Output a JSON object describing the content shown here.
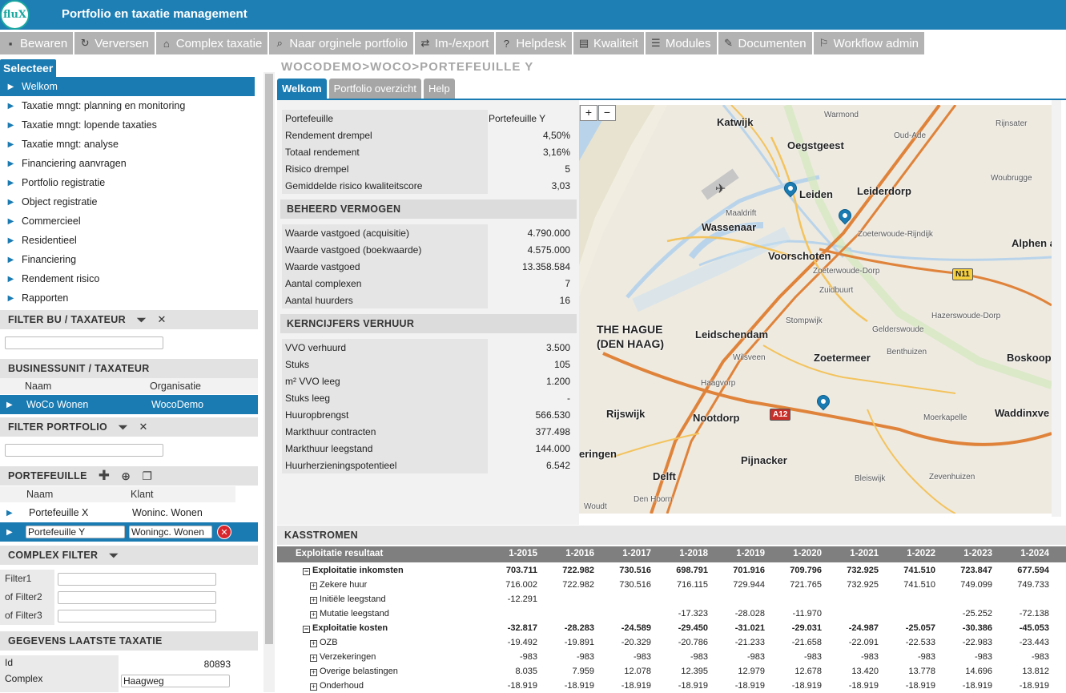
{
  "app": {
    "logo": "fluX",
    "title": "Portfolio en taxatie management"
  },
  "toolbar": [
    {
      "icon": "save-icon",
      "glyph": "▪",
      "label": "Bewaren"
    },
    {
      "icon": "refresh-icon",
      "glyph": "↻",
      "label": "Verversen"
    },
    {
      "icon": "home-icon",
      "glyph": "⌂",
      "label": "Complex taxatie"
    },
    {
      "icon": "search-icon",
      "glyph": "⌕",
      "label": "Naar orginele portfolio"
    },
    {
      "icon": "import-export-icon",
      "glyph": "⇄",
      "label": "Im-/export"
    },
    {
      "icon": "help-icon",
      "glyph": "?",
      "label": "Helpdesk"
    },
    {
      "icon": "quality-icon",
      "glyph": "▤",
      "label": "Kwaliteit"
    },
    {
      "icon": "modules-icon",
      "glyph": "☰",
      "label": "Modules"
    },
    {
      "icon": "documents-icon",
      "glyph": "✎",
      "label": "Documenten"
    },
    {
      "icon": "workflow-icon",
      "glyph": "⚐",
      "label": "Workflow admin"
    }
  ],
  "left": {
    "selecteer": "Selecteer",
    "nav": [
      "Welkom",
      "Taxatie mngt: planning en monitoring",
      "Taxatie mngt: lopende taxaties",
      "Taxatie mngt: analyse",
      "Financiering aanvragen",
      "Portfolio registratie",
      "Object registratie",
      "Commercieel",
      "Residentieel",
      "Financiering",
      "Rendement risico",
      "Rapporten"
    ],
    "filter_bu": "FILTER BU / TAXATEUR",
    "bu_head": "BUSINESSUNIT / TAXATEUR",
    "bu_cols": {
      "naam": "Naam",
      "organisatie": "Organisatie"
    },
    "bu_row": {
      "naam": "WoCo Wonen",
      "organisatie": "WocoDemo"
    },
    "filter_portfolio": "FILTER PORTFOLIO",
    "portefeuille": "PORTEFEUILLE",
    "pf_cols": {
      "naam": "Naam",
      "klant": "Klant"
    },
    "pf_row1": {
      "naam": "Portefeuille X",
      "klant": "Woninc. Wonen"
    },
    "pf_row2": {
      "naam": "Portefeuille Y",
      "klant": "Woningc. Wonen"
    },
    "complex_filter": "COMPLEX FILTER",
    "filters": [
      "Filter1",
      "of Filter2",
      "of Filter3"
    ],
    "gegevens": "GEGEVENS LAATSTE TAXATIE",
    "gegevens_rows": {
      "id_label": "Id",
      "id_value": "80893",
      "complex_label": "Complex",
      "complex_value": "Haagweg"
    }
  },
  "main": {
    "breadcrumb": "WOCODEMO>WOCO>PORTEFEUILLE Y",
    "tabs": [
      "Welkom",
      "Portfolio overzicht",
      "Help"
    ],
    "summary": [
      {
        "label": "Portefeuille",
        "value": "Portefeuille Y"
      },
      {
        "label": "Rendement drempel",
        "value": "4,50%"
      },
      {
        "label": "Totaal rendement",
        "value": "3,16%"
      },
      {
        "label": "Risico drempel",
        "value": "5"
      },
      {
        "label": "Gemiddelde risico kwaliteitscore",
        "value": "3,03"
      }
    ],
    "beheerd_head": "BEHEERD VERMOGEN",
    "beheerd": [
      {
        "label": "Waarde vastgoed (acquisitie)",
        "value": "4.790.000"
      },
      {
        "label": "Waarde vastgoed (boekwaarde)",
        "value": "4.575.000"
      },
      {
        "label": "Waarde vastgoed",
        "value": "13.358.584"
      },
      {
        "label": "Aantal complexen",
        "value": "7"
      },
      {
        "label": "Aantal huurders",
        "value": "16"
      }
    ],
    "kern_head": "KERNCIJFERS VERHUUR",
    "kern": [
      {
        "label": "VVO verhuurd",
        "value": "3.500"
      },
      {
        "label": "Stuks",
        "value": "105"
      },
      {
        "label": "m² VVO leeg",
        "value": "1.200"
      },
      {
        "label": "Stuks leeg",
        "value": "-"
      },
      {
        "label": "Huuropbrengst",
        "value": "566.530"
      },
      {
        "label": "Markthuur contracten",
        "value": "377.498"
      },
      {
        "label": "Markthuur leegstand",
        "value": "144.000"
      },
      {
        "label": "Huurherzieningspotentieel",
        "value": "6.542"
      }
    ],
    "map": {
      "zoom_in": "+",
      "zoom_out": "−",
      "places": [
        "Katwijk",
        "Oegstgeest",
        "Leiden",
        "Leiderdorp",
        "Wassenaar",
        "Voorschoten",
        "Alphen aa",
        "THE HAGUE",
        "(DEN HAAG)",
        "Leidschendam",
        "Zoetermeer",
        "Boskoop",
        "Rijswijk",
        "Nootdorp",
        "Waddinxve",
        "eringen",
        "Pijnacker",
        "Delft",
        "Warmond",
        "Oud-Ade",
        "Rijnsater",
        "Woubrugge",
        "Maaldrift",
        "Zoeterwoude-Rijndijk",
        "Zoeterwoude-Dorp",
        "Zuidbuurt",
        "Stompwijk",
        "Gelderswoude",
        "Hazerswoude-Dorp",
        "Wilsveen",
        "Benthuizen",
        "Haagvorp",
        "Moerkapelle",
        "Bleiswijk",
        "Zevenhuizen",
        "Woudt",
        "Den Hoorn"
      ],
      "roads": [
        "N11",
        "A12"
      ]
    },
    "kasstromen": {
      "head": "KASSTROMEN",
      "title": "Exploitatie resultaat",
      "years": [
        "1-2015",
        "1-2016",
        "1-2017",
        "1-2018",
        "1-2019",
        "1-2020",
        "1-2021",
        "1-2022",
        "1-2023",
        "1-2024"
      ],
      "rows": [
        {
          "label": "Exploitatie inkomsten",
          "level": 0,
          "sign": "−",
          "bold": true,
          "values": [
            "703.711",
            "722.982",
            "730.516",
            "698.791",
            "701.916",
            "709.796",
            "732.925",
            "741.510",
            "723.847",
            "677.594"
          ]
        },
        {
          "label": "Zekere huur",
          "level": 1,
          "sign": "+",
          "bold": false,
          "values": [
            "716.002",
            "722.982",
            "730.516",
            "716.115",
            "729.944",
            "721.765",
            "732.925",
            "741.510",
            "749.099",
            "749.733"
          ]
        },
        {
          "label": "Initiële leegstand",
          "level": 1,
          "sign": "+",
          "bold": false,
          "values": [
            "-12.291",
            "",
            "",
            "",
            "",
            "",
            "",
            "",
            "",
            ""
          ]
        },
        {
          "label": "Mutatie leegstand",
          "level": 1,
          "sign": "+",
          "bold": false,
          "values": [
            "",
            "",
            "",
            "-17.323",
            "-28.028",
            "-11.970",
            "",
            "",
            "-25.252",
            "-72.138"
          ]
        },
        {
          "label": "Exploitatie kosten",
          "level": 0,
          "sign": "−",
          "bold": true,
          "values": [
            "-32.817",
            "-28.283",
            "-24.589",
            "-29.450",
            "-31.021",
            "-29.031",
            "-24.987",
            "-25.057",
            "-30.386",
            "-45.053"
          ]
        },
        {
          "label": "OZB",
          "level": 1,
          "sign": "+",
          "bold": false,
          "values": [
            "-19.492",
            "-19.891",
            "-20.329",
            "-20.786",
            "-21.233",
            "-21.658",
            "-22.091",
            "-22.533",
            "-22.983",
            "-23.443"
          ]
        },
        {
          "label": "Verzekeringen",
          "level": 1,
          "sign": "+",
          "bold": false,
          "values": [
            "-983",
            "-983",
            "-983",
            "-983",
            "-983",
            "-983",
            "-983",
            "-983",
            "-983",
            "-983"
          ]
        },
        {
          "label": "Overige belastingen",
          "level": 1,
          "sign": "+",
          "bold": false,
          "values": [
            "8.035",
            "7.959",
            "12.078",
            "12.395",
            "12.979",
            "12.678",
            "13.420",
            "13.778",
            "14.696",
            "13.812"
          ]
        },
        {
          "label": "Onderhoud",
          "level": 1,
          "sign": "+",
          "bold": false,
          "values": [
            "-18.919",
            "-18.919",
            "-18.919",
            "-18.919",
            "-18.919",
            "-18.919",
            "-18.919",
            "-18.919",
            "-18.919",
            "-18.919"
          ]
        }
      ]
    }
  },
  "colors": {
    "brand": "#1e7fb5",
    "active": "#1a7bb2",
    "toolbar": "#b3b3b3"
  }
}
